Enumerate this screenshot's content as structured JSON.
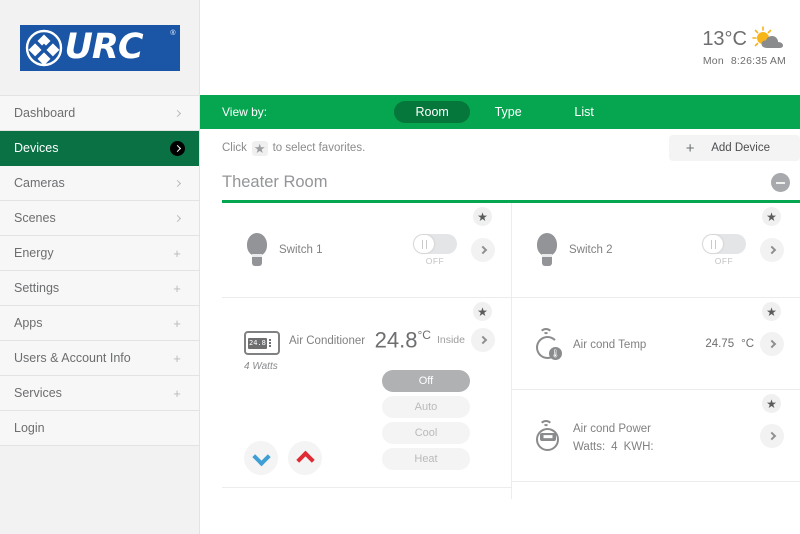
{
  "brand": {
    "name": "URC",
    "registered": "®",
    "logo_color": "#1b55a5"
  },
  "colors": {
    "accent_green": "#06a550",
    "sidebar_active_green": "#0a7145",
    "cool_blue": "#3f9fd5",
    "heat_red": "#e02a34"
  },
  "sidebar": {
    "items": [
      {
        "label": "Dashboard",
        "indicator": "chevron-right-icon"
      },
      {
        "label": "Devices",
        "indicator": "chevron-right-icon",
        "active": true
      },
      {
        "label": "Cameras",
        "indicator": "chevron-right-icon"
      },
      {
        "label": "Scenes",
        "indicator": "chevron-right-icon"
      },
      {
        "label": "Energy",
        "indicator": "plus-icon"
      },
      {
        "label": "Settings",
        "indicator": "plus-icon"
      },
      {
        "label": "Apps",
        "indicator": "plus-icon"
      },
      {
        "label": "Users & Account Info",
        "indicator": "plus-icon"
      },
      {
        "label": "Services",
        "indicator": "plus-icon"
      },
      {
        "label": "Login",
        "indicator": "none"
      }
    ]
  },
  "header": {
    "weather": {
      "temperature": "13°C",
      "icon": "sun-behind-cloud-icon"
    },
    "clock": {
      "day": "Mon",
      "time": "8:26:35 AM"
    }
  },
  "viewbar": {
    "label": "View by:",
    "tabs": [
      {
        "label": "Room",
        "active": true
      },
      {
        "label": "Type",
        "active": false
      },
      {
        "label": "List",
        "active": false
      }
    ]
  },
  "favorites_hint": {
    "prefix": "Click",
    "star": "★",
    "suffix": "to select favorites."
  },
  "add_device": {
    "plus": "+",
    "label": "Add Device"
  },
  "room": {
    "title": "Theater Room",
    "collapse_icon": "minus-circle-icon"
  },
  "devices": {
    "left": [
      {
        "type": "switch",
        "icon": "light-bulb-icon",
        "name": "Switch 1",
        "toggle_state": "OFF",
        "star": "★",
        "go": "chevron-right-icon"
      },
      {
        "type": "thermostat",
        "icon": "thermostat-icon",
        "icon_reading": "24.8",
        "name": "Air Conditioner",
        "watts": "4 Watts",
        "temperature": "24.8",
        "temperature_unit": "°C",
        "temperature_location": "Inside",
        "star": "★",
        "go": "chevron-right-icon",
        "modes": [
          {
            "label": "Off",
            "selected": true
          },
          {
            "label": "Auto",
            "selected": false
          },
          {
            "label": "Cool",
            "selected": false
          },
          {
            "label": "Heat",
            "selected": false
          }
        ],
        "steppers": [
          {
            "name": "temp-down",
            "icon": "chevron-down-icon"
          },
          {
            "name": "temp-up",
            "icon": "chevron-up-icon"
          }
        ]
      }
    ],
    "right": [
      {
        "type": "switch",
        "icon": "light-bulb-icon",
        "name": "Switch 2",
        "toggle_state": "OFF",
        "star": "★",
        "go": "chevron-right-icon"
      },
      {
        "type": "temp_sensor",
        "icon": "wireless-temperature-sensor-icon",
        "name": "Air cond Temp",
        "value": "24.75",
        "unit": "°C",
        "star": "★",
        "go": "chevron-right-icon"
      },
      {
        "type": "power_sensor",
        "icon": "wireless-power-meter-icon",
        "name": "Air cond Power",
        "watts_label": "Watts:",
        "watts_value": "4",
        "kwh_label": "KWH:",
        "kwh_value": "",
        "star": "★",
        "go": "chevron-right-icon"
      }
    ]
  }
}
